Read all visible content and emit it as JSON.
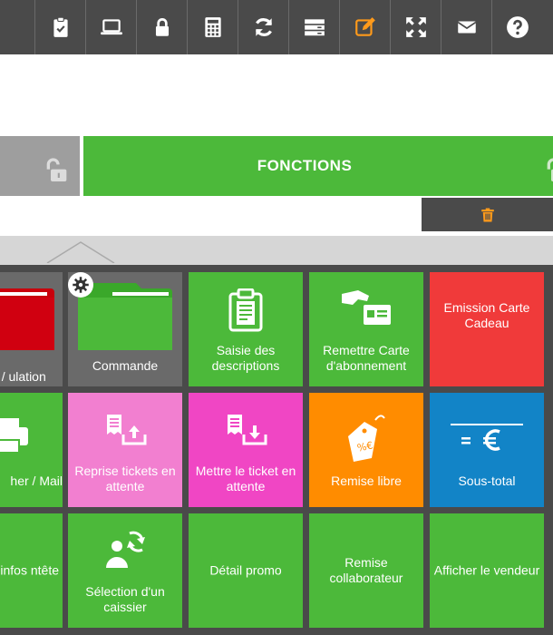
{
  "toolbar": {
    "items": [
      {
        "name": "clipboard-check"
      },
      {
        "name": "laptop"
      },
      {
        "name": "lock"
      },
      {
        "name": "calculator"
      },
      {
        "name": "refresh"
      },
      {
        "name": "drawers"
      },
      {
        "name": "edit",
        "color": "#ff9a1a"
      },
      {
        "name": "fullscreen"
      },
      {
        "name": "mail"
      },
      {
        "name": "help"
      }
    ]
  },
  "header": {
    "fonctions_label": "FONCTIONS"
  },
  "tiles": {
    "r1": [
      {
        "label": "ctions / ulation"
      },
      {
        "label": "Commande"
      },
      {
        "label": "Saisie des descriptions"
      },
      {
        "label": "Remettre Carte d'abonnement"
      },
      {
        "label": "Emission Carte Cadeau"
      }
    ],
    "r2": [
      {
        "label": "her / Mail"
      },
      {
        "label": "Reprise tickets en attente"
      },
      {
        "label": "Mettre le ticket en attente"
      },
      {
        "label": "Remise libre"
      },
      {
        "label": "Sous-total"
      }
    ],
    "r3": [
      {
        "label": "r les infos ntête"
      },
      {
        "label": "Sélection d'un caissier"
      },
      {
        "label": "Détail promo"
      },
      {
        "label": "Remise collaborateur"
      },
      {
        "label": "Afficher le vendeur"
      }
    ]
  },
  "colors": {
    "green": "#4cb93a",
    "red": "#f03a3a",
    "pink_light": "#f27fd0",
    "pink": "#f046c4",
    "orange": "#ff8c00",
    "blue": "#1284c7",
    "toolbar": "#4a4a4a"
  }
}
